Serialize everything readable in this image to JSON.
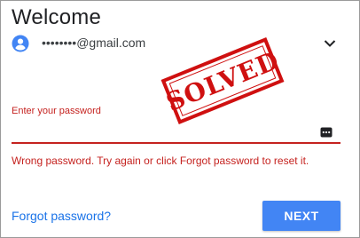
{
  "header": {
    "title": "Welcome"
  },
  "account": {
    "email": "••••••••@gmail.com",
    "avatar_icon": "account-circle-icon",
    "chevron_icon": "chevron-down-icon"
  },
  "stamp": {
    "text": "SOLVED",
    "color": "#cf1010"
  },
  "password": {
    "label": "Enter your password",
    "toggle_icon": "show-password-icon",
    "error": "Wrong password. Try again or click Forgot password to reset it."
  },
  "footer": {
    "forgot_label": "Forgot password?",
    "next_label": "NEXT"
  },
  "colors": {
    "accent": "#4285f4",
    "link": "#1a73e8",
    "error": "#c5221f",
    "avatar": "#4285f4"
  }
}
